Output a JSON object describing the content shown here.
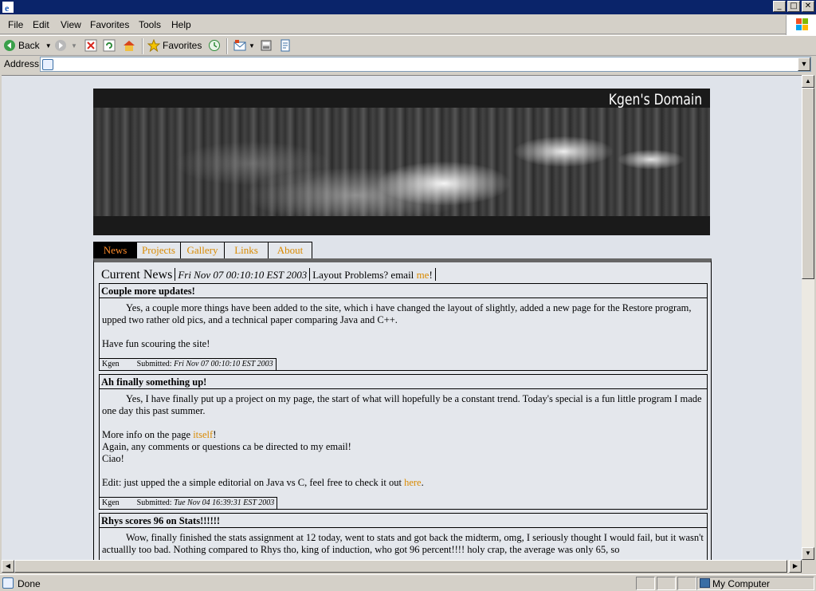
{
  "window": {
    "buttons": [
      "_",
      "□",
      "✕"
    ]
  },
  "menu": {
    "items": [
      "File",
      "Edit",
      "View",
      "Favorites",
      "Tools",
      "Help"
    ]
  },
  "toolbar": {
    "back_label": "Back",
    "favorites_label": "Favorites"
  },
  "address": {
    "label": "Address",
    "value": ""
  },
  "page": {
    "site_title": "Kgen's Domain",
    "tabs": [
      "News",
      "Projects",
      "Gallery",
      "Links",
      "About"
    ],
    "current_news": {
      "title": "Current News",
      "date": "Fri Nov 07 00:10:10 EST 2003",
      "layout_text": "Layout Problems? email ",
      "email_link": "me",
      "email_suffix": "!"
    },
    "posts": [
      {
        "title": "Couple more updates!",
        "body1": "Yes, a couple more things have been added to the site, which i have changed the layout of slightly, added a new page for the Restore program, upped two rather old pics, and a technical paper comparing Java and C++.",
        "body2": "Have fun scouring the site!",
        "author": "Kgen",
        "submitted_label": "Submitted: ",
        "submitted": "Fri Nov 07 00:10:10 EST 2003"
      },
      {
        "title": "Ah finally something up!",
        "body1": "Yes, I have finally put up a project on my page, the start of what will hopefully be a constant trend. Today's special is a fun little program I made one day this past summer.",
        "more_info_prefix": "More info on the page ",
        "more_info_link": "itself",
        "more_info_suffix": "!",
        "line_again": "Again, any comments or questions ca be directed to my email!",
        "line_ciao": "Ciao!",
        "edit_prefix": "Edit: just upped the a simple editorial on Java vs C, feel free to check it out ",
        "edit_link": "here",
        "edit_suffix": ".",
        "author": "Kgen",
        "submitted_label": "Submitted: ",
        "submitted": "Tue Nov 04 16:39:31 EST 2003"
      },
      {
        "title": "Rhys scores 96 on Stats!!!!!!",
        "body1": "Wow, finally finished the stats assignment at 12 today, went to stats and got back the midterm, omg, I seriously thought I would fail, but it wasn't actuallly too bad. Nothing compared to Rhys tho, king of induction, who got 96 percent!!!! holy crap, the average was only 65, so"
      }
    ]
  },
  "status": {
    "text": "Done",
    "zone": "My Computer"
  }
}
